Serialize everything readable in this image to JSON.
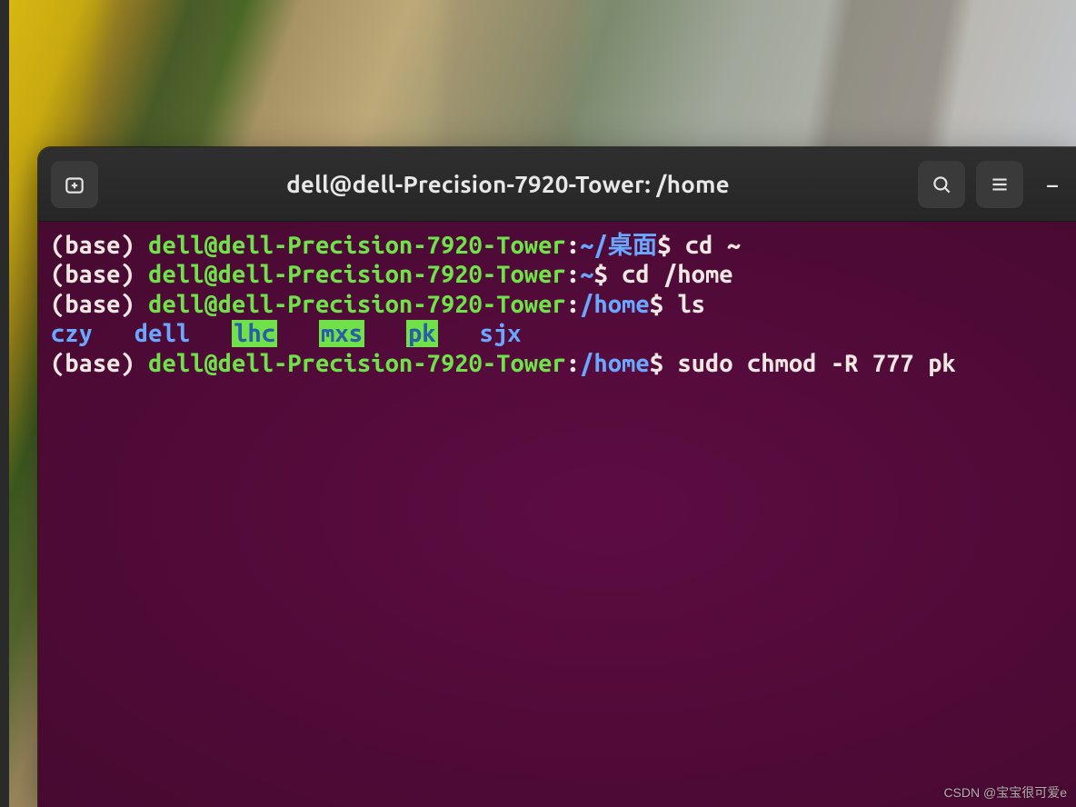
{
  "window": {
    "title": "dell@dell-Precision-7920-Tower: /home"
  },
  "titlebar": {
    "new_tab_tooltip": "New Tab",
    "search_tooltip": "Search",
    "menu_tooltip": "Menu",
    "minimize_tooltip": "Minimize"
  },
  "prompt": {
    "env": "(base) ",
    "userhost": "dell@dell-Precision-7920-Tower",
    "sep": ":",
    "dollar": "$ "
  },
  "lines": [
    {
      "path": "~/桌面",
      "path_style": "blue",
      "cmd": "cd ~"
    },
    {
      "path": "~",
      "path_style": "blue",
      "cmd": "cd /home"
    },
    {
      "path": "/home",
      "path_style": "blue",
      "cmd": "ls"
    }
  ],
  "ls_output": {
    "items": [
      {
        "name": "czy",
        "style": "blue"
      },
      {
        "name": "dell",
        "style": "blue"
      },
      {
        "name": "lhc",
        "style": "hi"
      },
      {
        "name": "mxs",
        "style": "hi"
      },
      {
        "name": "pk",
        "style": "hi"
      },
      {
        "name": "sjx",
        "style": "blue"
      }
    ],
    "gap": "   "
  },
  "current": {
    "path": "/home",
    "path_style": "blue",
    "cmd": "sudo chmod -R 777 pk"
  },
  "watermark": "CSDN @宝宝很可爱e",
  "colors": {
    "bg_terminal": "#4a0a33",
    "titlebar": "#2b2b2b",
    "prompt_user": "#6fe24a",
    "path_blue": "#6aa7ff",
    "ls_highlight_bg": "#6fe24a",
    "ls_highlight_fg": "#2a5da8",
    "text": "#efe8e2"
  }
}
